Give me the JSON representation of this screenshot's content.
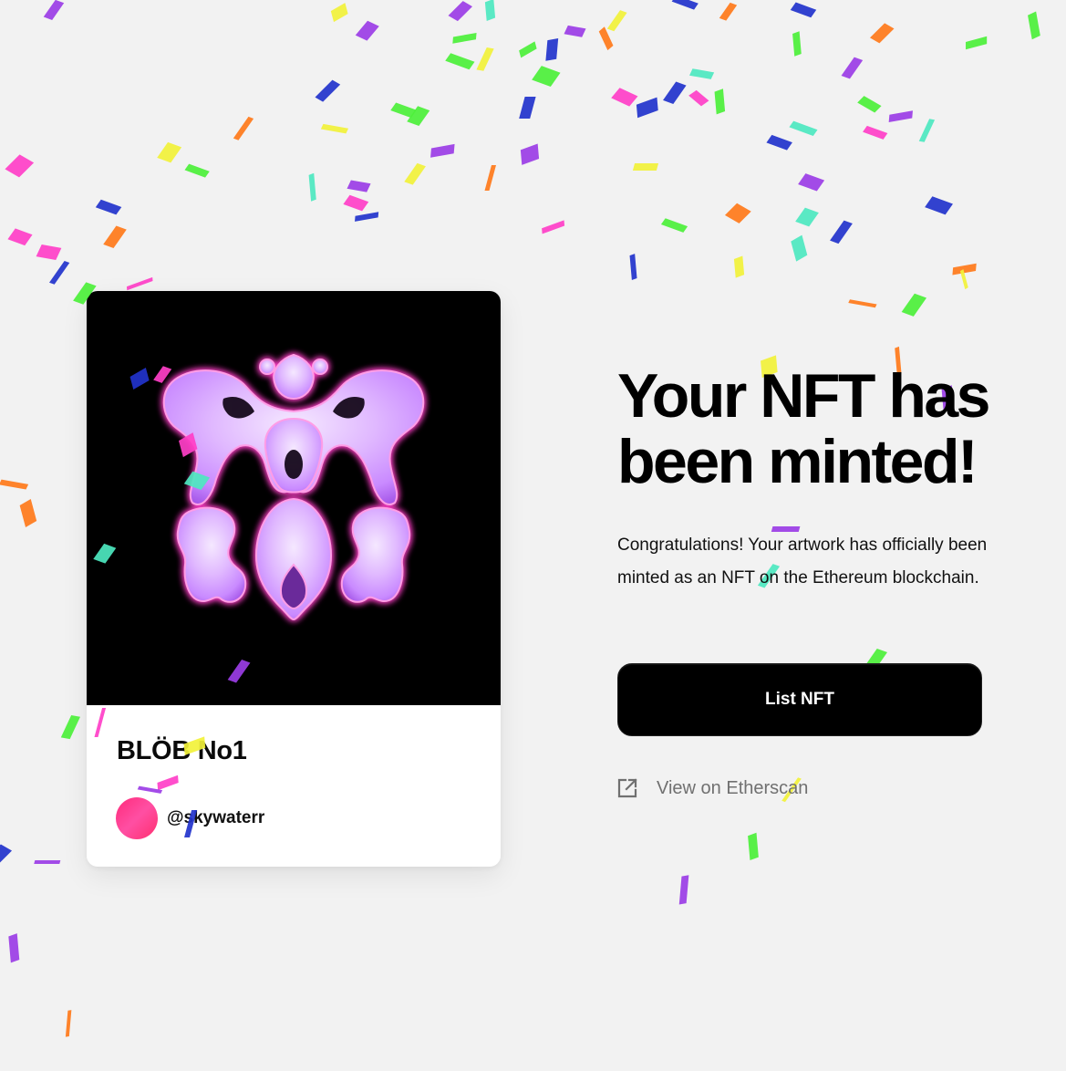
{
  "nft_card": {
    "title": "BLÖB No1",
    "creator_handle": "@skywaterr"
  },
  "success": {
    "headline_line1": "Your NFT has",
    "headline_line2": "been minted!",
    "description": "Congratulations! Your artwork has officially been minted as an NFT on the Ethereum blockchain.",
    "list_button_label": "List NFT",
    "etherscan_link_label": "View on Etherscan",
    "etherscan_icon": "external-link-icon"
  },
  "colors": {
    "background": "#f2f2f2",
    "primary_button": "#000000",
    "avatar": "#ff2e7e",
    "link_text": "#707070",
    "artwork_glow": "#ff3fc8",
    "confetti": [
      "#ff3fc8",
      "#9b3de6",
      "#2233cc",
      "#4cf03a",
      "#f2f23a",
      "#4de8c0",
      "#ff7a1a"
    ]
  }
}
